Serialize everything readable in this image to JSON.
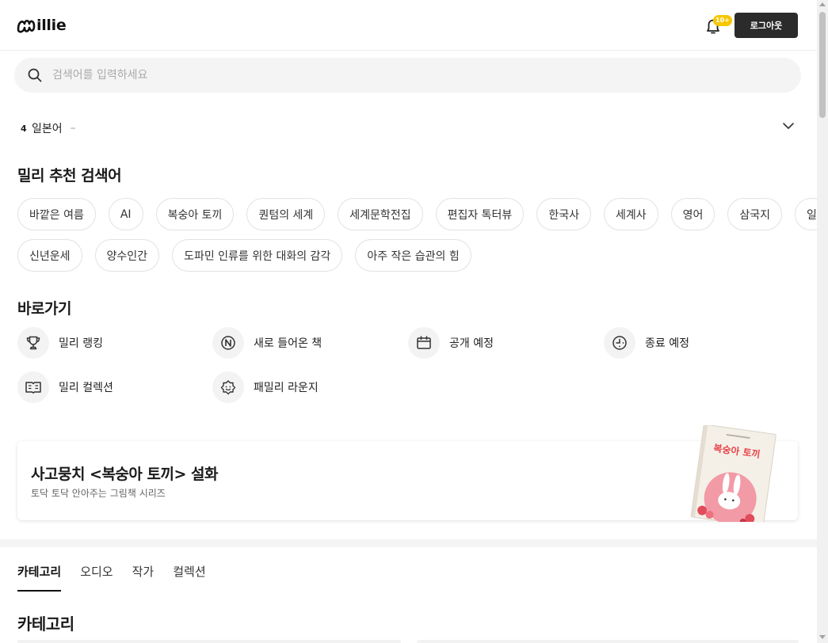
{
  "header": {
    "logo_text": "illie",
    "notification_badge": "10+",
    "logout_label": "로그아웃"
  },
  "search": {
    "placeholder": "검색어를 입력하세요"
  },
  "ranking": {
    "number": "4",
    "term": "일본어",
    "change": "–"
  },
  "recommended": {
    "title": "밀리 추천 검색어",
    "row1": [
      "바깥은 여름",
      "AI",
      "복숭아 토끼",
      "퀀텀의 세계",
      "세계문학전집",
      "편집자 톡터뷰",
      "한국사",
      "세계사",
      "영어",
      "삼국지",
      "일"
    ],
    "row2": [
      "신년운세",
      "양수인간",
      "도파민 인류를 위한 대화의 감각",
      "아주 작은 습관의 힘"
    ]
  },
  "shortcuts": {
    "title": "바로가기",
    "items": [
      {
        "label": "밀리 랭킹",
        "icon": "trophy-icon"
      },
      {
        "label": "새로 들어온 책",
        "icon": "new-badge-icon"
      },
      {
        "label": "공개 예정",
        "icon": "calendar-icon"
      },
      {
        "label": "종료 예정",
        "icon": "clock-icon"
      },
      {
        "label": "밀리 컬렉션",
        "icon": "open-book-icon"
      },
      {
        "label": "패밀리 라운지",
        "icon": "family-face-icon"
      }
    ]
  },
  "banner": {
    "title": "사고뭉치 <복숭아 토끼> 설화",
    "subtitle": "토닥 토닥 안아주는 그림책 시리즈",
    "book_cover_title": "복숭아 토끼"
  },
  "tabs": {
    "items": [
      "카테고리",
      "오디오",
      "작가",
      "컬렉션"
    ],
    "active": "카테고리"
  },
  "category": {
    "title": "카테고리"
  },
  "colors": {
    "badge": "#f6c700",
    "logout_bg": "#2b2b2b",
    "search_bg": "#f4f4f4",
    "book_title": "#e8434a",
    "book_pink": "#f29aa6"
  }
}
